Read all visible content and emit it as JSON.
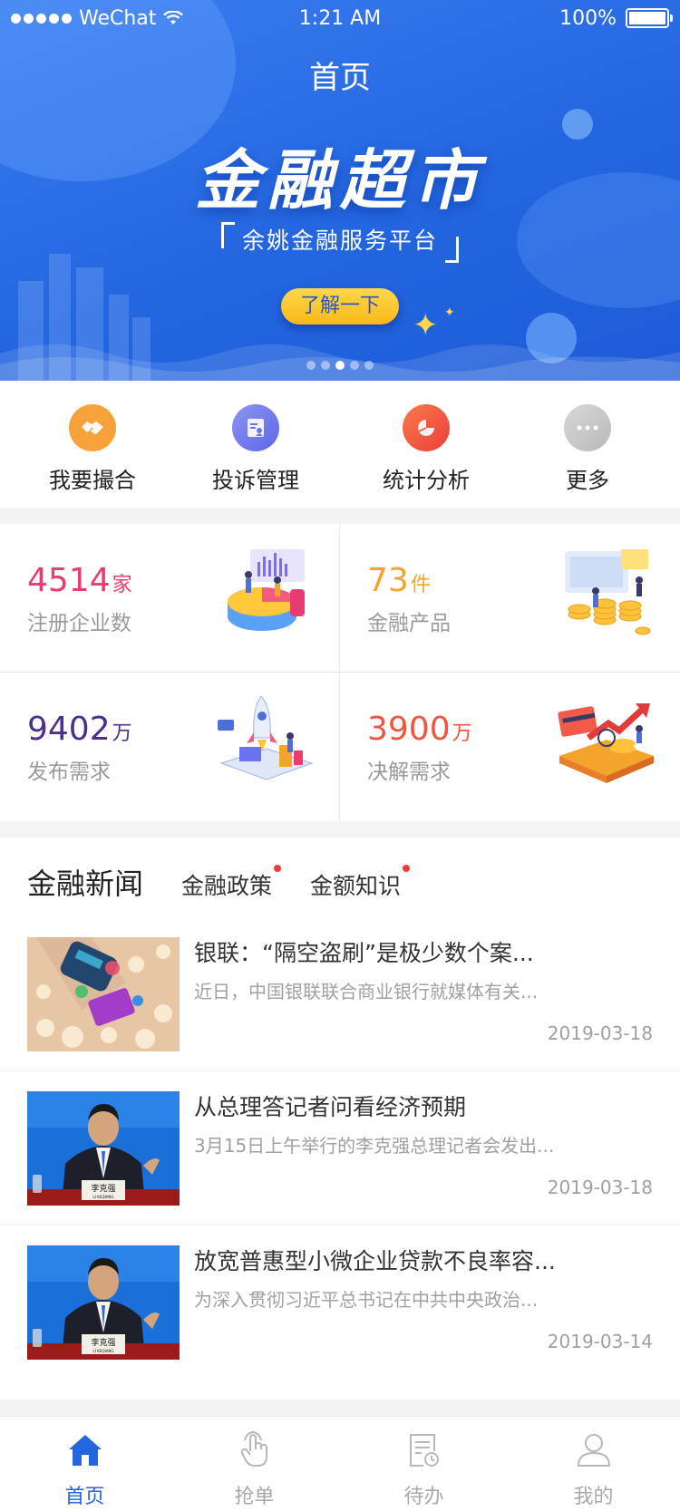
{
  "status_bar": {
    "carrier": "WeChat",
    "time": "1:21 AM",
    "battery": "100%"
  },
  "header": {
    "title": "首页"
  },
  "banner": {
    "title": "金融超市",
    "subtitle": "余姚金融服务平台",
    "button_label": "了解一下",
    "page_count": 5,
    "active_page": 3
  },
  "quick_menu": [
    {
      "label": "我要撮合",
      "icon": "handshake-icon",
      "color": "#f7a13a"
    },
    {
      "label": "投诉管理",
      "icon": "complaint-icon",
      "color": "#6b74ee"
    },
    {
      "label": "统计分析",
      "icon": "pie-chart-icon",
      "color": "#f2553d"
    },
    {
      "label": "更多",
      "icon": "more-icon",
      "color": "#c8c8c8"
    }
  ],
  "stats": [
    {
      "value": "4514",
      "unit": "家",
      "label": "注册企业数",
      "color": "#ea3d6e"
    },
    {
      "value": "73",
      "unit": "件",
      "label": "金融产品",
      "color": "#f3a42a"
    },
    {
      "value": "9402",
      "unit": "万",
      "label": "发布需求",
      "color": "#4c2f8c"
    },
    {
      "value": "3900",
      "unit": "万",
      "label": "决解需求",
      "color": "#f2553d"
    }
  ],
  "news": {
    "tabs": {
      "main": "金融新闻",
      "second": "金融政策",
      "third": "金额知识"
    },
    "items": [
      {
        "title": "银联：“隔空盗刷”是极少数个案...",
        "summary": "近日，中国银联联合商业银行就媒体有关...",
        "date": "2019-03-18",
        "image": "card-payment-photo"
      },
      {
        "title": "从总理答记者问看经济预期",
        "summary": "3月15日上午举行的李克强总理记者会发出...",
        "date": "2019-03-18",
        "image": "press-conference-photo",
        "nameplate": "李克强",
        "nameplate_en": "LI KEQIANG"
      },
      {
        "title": "放宽普惠型小微企业贷款不良率容...",
        "summary": "为深入贯彻习近平总书记在中共中央政治...",
        "date": "2019-03-14",
        "image": "press-conference-photo",
        "nameplate": "李克强",
        "nameplate_en": "LI KEQIANG"
      }
    ]
  },
  "tabbar": [
    {
      "label": "首页",
      "icon": "home-icon",
      "active": true
    },
    {
      "label": "抢单",
      "icon": "tap-hand-icon",
      "active": false
    },
    {
      "label": "待办",
      "icon": "todo-doc-icon",
      "active": false
    },
    {
      "label": "我的",
      "icon": "user-icon",
      "active": false
    }
  ],
  "colors": {
    "accent": "#2466e0",
    "button_yellow": "#fbc52a",
    "inactive": "#a8a8a8"
  }
}
